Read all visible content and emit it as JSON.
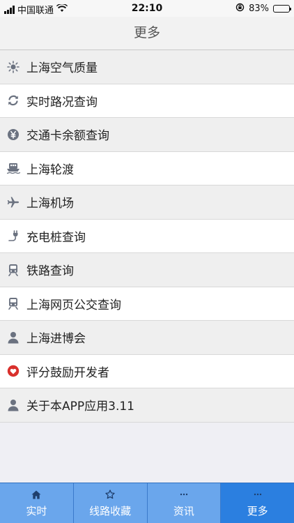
{
  "status": {
    "carrier": "中国联通",
    "time": "22:10",
    "battery": "83%",
    "battery_level": 0.83
  },
  "header": {
    "title": "更多"
  },
  "menu": [
    {
      "label": "上海空气质量",
      "icon": "sun-icon"
    },
    {
      "label": "实时路况查询",
      "icon": "refresh-icon"
    },
    {
      "label": "交通卡余额查询",
      "icon": "yen-icon"
    },
    {
      "label": "上海轮渡",
      "icon": "ferry-icon"
    },
    {
      "label": "上海机场",
      "icon": "airplane-icon"
    },
    {
      "label": "充电桩查询",
      "icon": "plug-icon"
    },
    {
      "label": "铁路查询",
      "icon": "train-icon"
    },
    {
      "label": "上海网页公交查询",
      "icon": "train-icon"
    },
    {
      "label": "上海进博会",
      "icon": "user-icon"
    },
    {
      "label": "评分鼓励开发者",
      "icon": "heart-icon"
    },
    {
      "label": "关于本APP应用3.11",
      "icon": "user-icon"
    }
  ],
  "tabs": [
    {
      "label": "实时",
      "icon": "home-icon"
    },
    {
      "label": "线路收藏",
      "icon": "star-icon"
    },
    {
      "label": "资讯",
      "icon": "ellipsis-icon"
    },
    {
      "label": "更多",
      "icon": "ellipsis-icon",
      "active": true
    }
  ],
  "colors": {
    "tab_bg": "#6aa6ec",
    "tab_active": "#2b7fe0",
    "heart": "#d9302c",
    "icon_gray": "#6b7280"
  }
}
